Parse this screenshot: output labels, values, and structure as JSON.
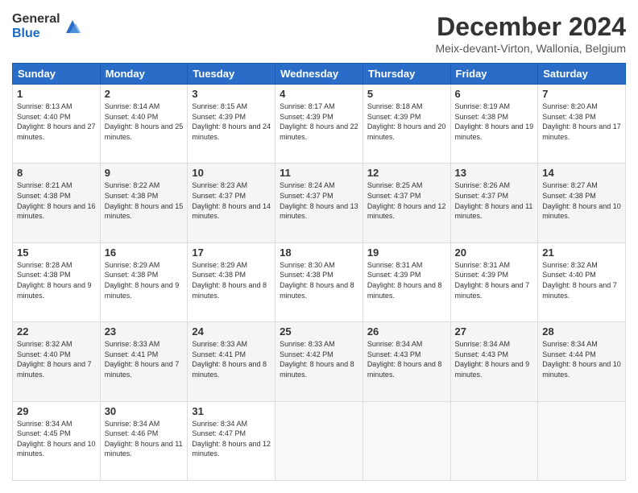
{
  "logo": {
    "general": "General",
    "blue": "Blue"
  },
  "header": {
    "title": "December 2024",
    "location": "Meix-devant-Virton, Wallonia, Belgium"
  },
  "weekdays": [
    "Sunday",
    "Monday",
    "Tuesday",
    "Wednesday",
    "Thursday",
    "Friday",
    "Saturday"
  ],
  "weeks": [
    [
      {
        "day": "1",
        "sunrise": "8:13 AM",
        "sunset": "4:40 PM",
        "daylight": "8 hours and 27 minutes."
      },
      {
        "day": "2",
        "sunrise": "8:14 AM",
        "sunset": "4:40 PM",
        "daylight": "8 hours and 25 minutes."
      },
      {
        "day": "3",
        "sunrise": "8:15 AM",
        "sunset": "4:39 PM",
        "daylight": "8 hours and 24 minutes."
      },
      {
        "day": "4",
        "sunrise": "8:17 AM",
        "sunset": "4:39 PM",
        "daylight": "8 hours and 22 minutes."
      },
      {
        "day": "5",
        "sunrise": "8:18 AM",
        "sunset": "4:39 PM",
        "daylight": "8 hours and 20 minutes."
      },
      {
        "day": "6",
        "sunrise": "8:19 AM",
        "sunset": "4:38 PM",
        "daylight": "8 hours and 19 minutes."
      },
      {
        "day": "7",
        "sunrise": "8:20 AM",
        "sunset": "4:38 PM",
        "daylight": "8 hours and 17 minutes."
      }
    ],
    [
      {
        "day": "8",
        "sunrise": "8:21 AM",
        "sunset": "4:38 PM",
        "daylight": "8 hours and 16 minutes."
      },
      {
        "day": "9",
        "sunrise": "8:22 AM",
        "sunset": "4:38 PM",
        "daylight": "8 hours and 15 minutes."
      },
      {
        "day": "10",
        "sunrise": "8:23 AM",
        "sunset": "4:37 PM",
        "daylight": "8 hours and 14 minutes."
      },
      {
        "day": "11",
        "sunrise": "8:24 AM",
        "sunset": "4:37 PM",
        "daylight": "8 hours and 13 minutes."
      },
      {
        "day": "12",
        "sunrise": "8:25 AM",
        "sunset": "4:37 PM",
        "daylight": "8 hours and 12 minutes."
      },
      {
        "day": "13",
        "sunrise": "8:26 AM",
        "sunset": "4:37 PM",
        "daylight": "8 hours and 11 minutes."
      },
      {
        "day": "14",
        "sunrise": "8:27 AM",
        "sunset": "4:38 PM",
        "daylight": "8 hours and 10 minutes."
      }
    ],
    [
      {
        "day": "15",
        "sunrise": "8:28 AM",
        "sunset": "4:38 PM",
        "daylight": "8 hours and 9 minutes."
      },
      {
        "day": "16",
        "sunrise": "8:29 AM",
        "sunset": "4:38 PM",
        "daylight": "8 hours and 9 minutes."
      },
      {
        "day": "17",
        "sunrise": "8:29 AM",
        "sunset": "4:38 PM",
        "daylight": "8 hours and 8 minutes."
      },
      {
        "day": "18",
        "sunrise": "8:30 AM",
        "sunset": "4:38 PM",
        "daylight": "8 hours and 8 minutes."
      },
      {
        "day": "19",
        "sunrise": "8:31 AM",
        "sunset": "4:39 PM",
        "daylight": "8 hours and 8 minutes."
      },
      {
        "day": "20",
        "sunrise": "8:31 AM",
        "sunset": "4:39 PM",
        "daylight": "8 hours and 7 minutes."
      },
      {
        "day": "21",
        "sunrise": "8:32 AM",
        "sunset": "4:40 PM",
        "daylight": "8 hours and 7 minutes."
      }
    ],
    [
      {
        "day": "22",
        "sunrise": "8:32 AM",
        "sunset": "4:40 PM",
        "daylight": "8 hours and 7 minutes."
      },
      {
        "day": "23",
        "sunrise": "8:33 AM",
        "sunset": "4:41 PM",
        "daylight": "8 hours and 7 minutes."
      },
      {
        "day": "24",
        "sunrise": "8:33 AM",
        "sunset": "4:41 PM",
        "daylight": "8 hours and 8 minutes."
      },
      {
        "day": "25",
        "sunrise": "8:33 AM",
        "sunset": "4:42 PM",
        "daylight": "8 hours and 8 minutes."
      },
      {
        "day": "26",
        "sunrise": "8:34 AM",
        "sunset": "4:43 PM",
        "daylight": "8 hours and 8 minutes."
      },
      {
        "day": "27",
        "sunrise": "8:34 AM",
        "sunset": "4:43 PM",
        "daylight": "8 hours and 9 minutes."
      },
      {
        "day": "28",
        "sunrise": "8:34 AM",
        "sunset": "4:44 PM",
        "daylight": "8 hours and 10 minutes."
      }
    ],
    [
      {
        "day": "29",
        "sunrise": "8:34 AM",
        "sunset": "4:45 PM",
        "daylight": "8 hours and 10 minutes."
      },
      {
        "day": "30",
        "sunrise": "8:34 AM",
        "sunset": "4:46 PM",
        "daylight": "8 hours and 11 minutes."
      },
      {
        "day": "31",
        "sunrise": "8:34 AM",
        "sunset": "4:47 PM",
        "daylight": "8 hours and 12 minutes."
      },
      null,
      null,
      null,
      null
    ]
  ],
  "labels": {
    "sunrise": "Sunrise:",
    "sunset": "Sunset:",
    "daylight": "Daylight:"
  }
}
